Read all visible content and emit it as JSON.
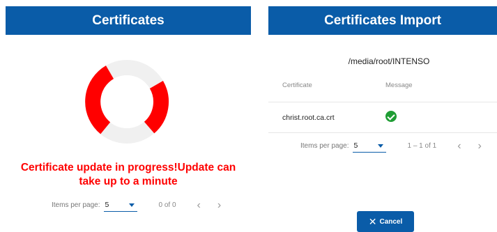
{
  "left_panel": {
    "title": "Certificates",
    "progress_message": "Certificate update in progress!Update can take up to a minute",
    "pager": {
      "items_label": "Items per page:",
      "page_size": "5",
      "range": "0 of 0",
      "prev": "‹",
      "next": "›"
    },
    "colors": {
      "spinner_track": "#f0f0f0",
      "spinner_active": "#ff0000"
    }
  },
  "right_panel": {
    "title": "Certificates Import",
    "path": "/media/root/INTENSO",
    "table": {
      "columns": [
        "Certificate",
        "Message"
      ],
      "rows": [
        {
          "certificate": "christ.root.ca.crt",
          "message_icon": "success-check-icon"
        }
      ]
    },
    "pager": {
      "items_label": "Items per page:",
      "page_size": "5",
      "range": "1 – 1 of 1",
      "prev": "‹",
      "next": "›"
    },
    "cancel_label": "Cancel",
    "cancel_icon": "close-icon"
  },
  "colors": {
    "header_bg": "#0a5ca8",
    "accent": "#0a5ca8",
    "error": "#ff0000",
    "success": "#1f9d34"
  }
}
